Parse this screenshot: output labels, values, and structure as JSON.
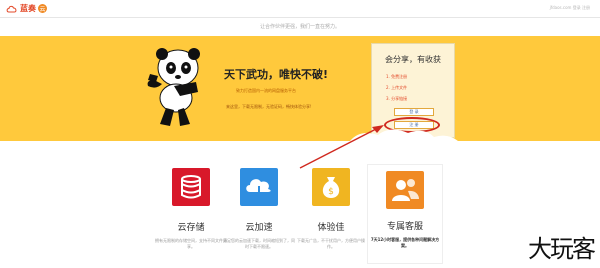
{
  "header": {
    "logo_text": "蓝奏",
    "logo_badge": "云",
    "top_links": "jfdaos.com 登录  注册"
  },
  "slogan": "让合作伙伴更强，我们一直在努力。",
  "hero": {
    "title": "天下武功，唯快不破!",
    "subtitle": "致力打造国内一流的网盘服务平台",
    "description": "来这里，下载无限制，无验证码，畅快体验分享!"
  },
  "share_box": {
    "title": "会分享，有收获",
    "items": [
      "1. 免费注册",
      "2. 上传文件",
      "3. 分享链接"
    ],
    "login_label": "登 录",
    "register_label": "注 册"
  },
  "features": [
    {
      "label": "云存储",
      "desc": "拥有无限制的存储空间，支持不同文件分享。",
      "icon": "database-icon",
      "color": "#d8182a"
    },
    {
      "label": "云加速",
      "desc": "满足您的云加速下载，时间缩短到了，同时下载不限速。",
      "icon": "cloud-download-icon",
      "color": "#2f8ee0"
    },
    {
      "label": "体验佳",
      "desc": "下载无广告，不干扰用户，方便用户操作。",
      "icon": "money-bag-icon",
      "color": "#f0b521"
    },
    {
      "label": "专属客服",
      "desc": "7天12小时客服，提供各种问题解决方案。",
      "icon": "customer-service-icon",
      "color": "#f08a24"
    }
  ],
  "watermark": "大玩客",
  "colors": {
    "hero_bg": "#ffc93c",
    "accent_red": "#d0291f",
    "brand_orange": "#e34a2a"
  }
}
